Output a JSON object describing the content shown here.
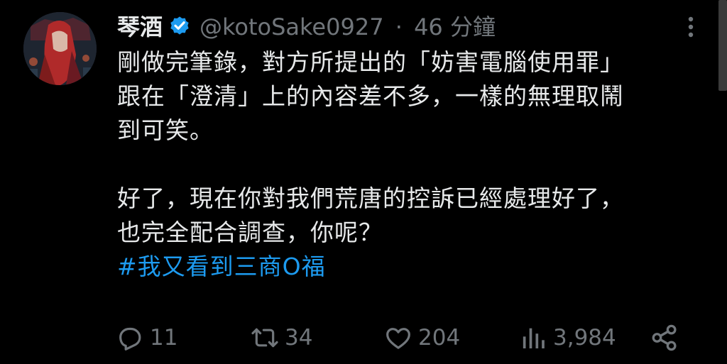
{
  "author": {
    "display_name": "琴酒",
    "handle": "@kotoSake0927",
    "separator": "·",
    "time": "46 分鐘",
    "verified": true
  },
  "tweet": {
    "lines": [
      "剛做完筆錄，對方所提出的「妨害電腦使用罪」",
      "跟在「澄清」上的內容差不多，一樣的無理取鬧",
      "到可笑。"
    ],
    "lines2": [
      "好了，現在你對我們荒唐的控訴已經處理好了，",
      "也完全配合調查，你呢？"
    ],
    "hashtag": "#我又看到三商O福"
  },
  "actions": {
    "replies": "11",
    "retweets": "34",
    "likes": "204",
    "views": "3,984"
  },
  "icons": {
    "verified": "verified-badge-icon",
    "more": "more-options-icon",
    "reply": "reply-icon",
    "retweet": "retweet-icon",
    "like": "heart-icon",
    "views": "views-icon",
    "share": "share-icon"
  },
  "colors": {
    "background": "#000000",
    "text": "#e7e9ea",
    "muted": "#71767b",
    "accent": "#1d9bf0"
  }
}
